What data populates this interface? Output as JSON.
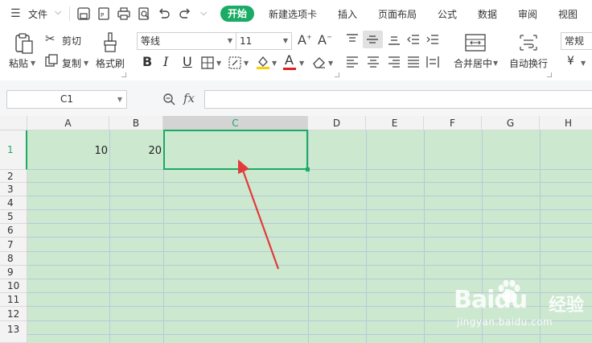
{
  "menu": {
    "file_label": "文件",
    "tabs": [
      "开始",
      "新建选项卡",
      "插入",
      "页面布局",
      "公式",
      "数据",
      "审阅",
      "视图"
    ],
    "active_tab": "开始"
  },
  "ribbon": {
    "paste": "粘贴",
    "cut": "剪切",
    "copy": "复制",
    "format_painter": "格式刷",
    "font_name": "等线",
    "font_size": "11",
    "merge_center": "合并居中",
    "wrap_text": "自动换行",
    "number_format": "常规",
    "currency": "¥",
    "bold": "B",
    "italic": "I",
    "underline": "U",
    "font_color_letter": "A"
  },
  "formula_bar": {
    "name_box": "C1",
    "fx": "fx",
    "formula": ""
  },
  "sheet": {
    "columns": [
      "A",
      "B",
      "C",
      "D",
      "E",
      "F",
      "G",
      "H"
    ],
    "rows": [
      "1",
      "2",
      "3",
      "4",
      "5",
      "6",
      "7",
      "8",
      "9",
      "10",
      "11",
      "12",
      "13"
    ],
    "selected_column": "C",
    "selected_row": "1",
    "cells": {
      "A1": "10",
      "B1": "20"
    }
  },
  "colors": {
    "accent": "#1aab64",
    "grid_bg": "#cce8cf",
    "annotation_arrow": "#e23b3b"
  },
  "watermark": {
    "brand": "Baidu",
    "brand_cn": "经验",
    "url": "jingyan.baidu.com"
  }
}
